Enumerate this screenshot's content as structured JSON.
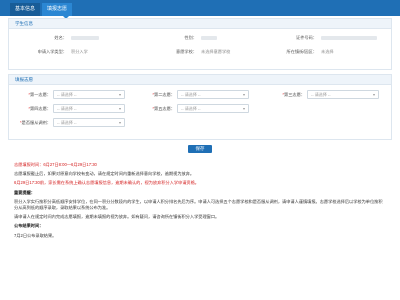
{
  "tabs": [
    {
      "label": "基本信息"
    },
    {
      "label": "填报志愿"
    }
  ],
  "info_section": {
    "title": "学生信息",
    "fields": {
      "name_label": "姓名：",
      "gender_label": "性别：",
      "id_label": "证件号码：",
      "type_label": "申请入学类型：",
      "type_value": "积分入学",
      "school_label": "意愿学校：",
      "school_value": "未选择意愿学校",
      "district_label": "所在镇街/园区：",
      "district_value": "未选择"
    }
  },
  "choice_section": {
    "title": "填报志愿",
    "selects": [
      {
        "label": "第一志愿：",
        "placeholder": "-- 请选择 --"
      },
      {
        "label": "第二志愿：",
        "placeholder": "-- 请选择 --"
      },
      {
        "label": "第三志愿：",
        "placeholder": "-- 请选择 --"
      },
      {
        "label": "第四志愿：",
        "placeholder": "-- 请选择 --"
      },
      {
        "label": "第五志愿：",
        "placeholder": "-- 请选择 --"
      },
      {
        "label": "是否服从调剂：",
        "placeholder": "-- 请选择 --"
      }
    ],
    "required_mark": "*"
  },
  "save_button": "保存",
  "notes": {
    "line1": "志愿填报时间：6月27日8:00—6月29日17:30",
    "line2": "志愿填报截止后，如果对原意向学校有变动，请在规定时间内重新选择意向学校，逾期视为放弃。",
    "line3": "6月29日17:30前，家长需在系统上确认志愿填报信息，逾期未确认的，视为放弃积分入学申请资格。",
    "title1": "重要提醒：",
    "para1": "积分入学实行按积分高低顺序安排学位，在同一积分分数段内的学生，以申请人积分排名先后为序。申请人可选择五个志愿学校和是否服从调剂，请申请人谨慎填报。志愿学校选择后以学校为单位按积分从高到低的顺序录取，录取结果以系统公布为准。",
    "para2": "请申请人在规定时间内完成志愿填报，逾期未填报的视为放弃。如有疑问，请咨询所在镇街积分入学受理窗口。",
    "title2": "公布结果时间：",
    "para3": "7月2日公布录取结果。"
  }
}
